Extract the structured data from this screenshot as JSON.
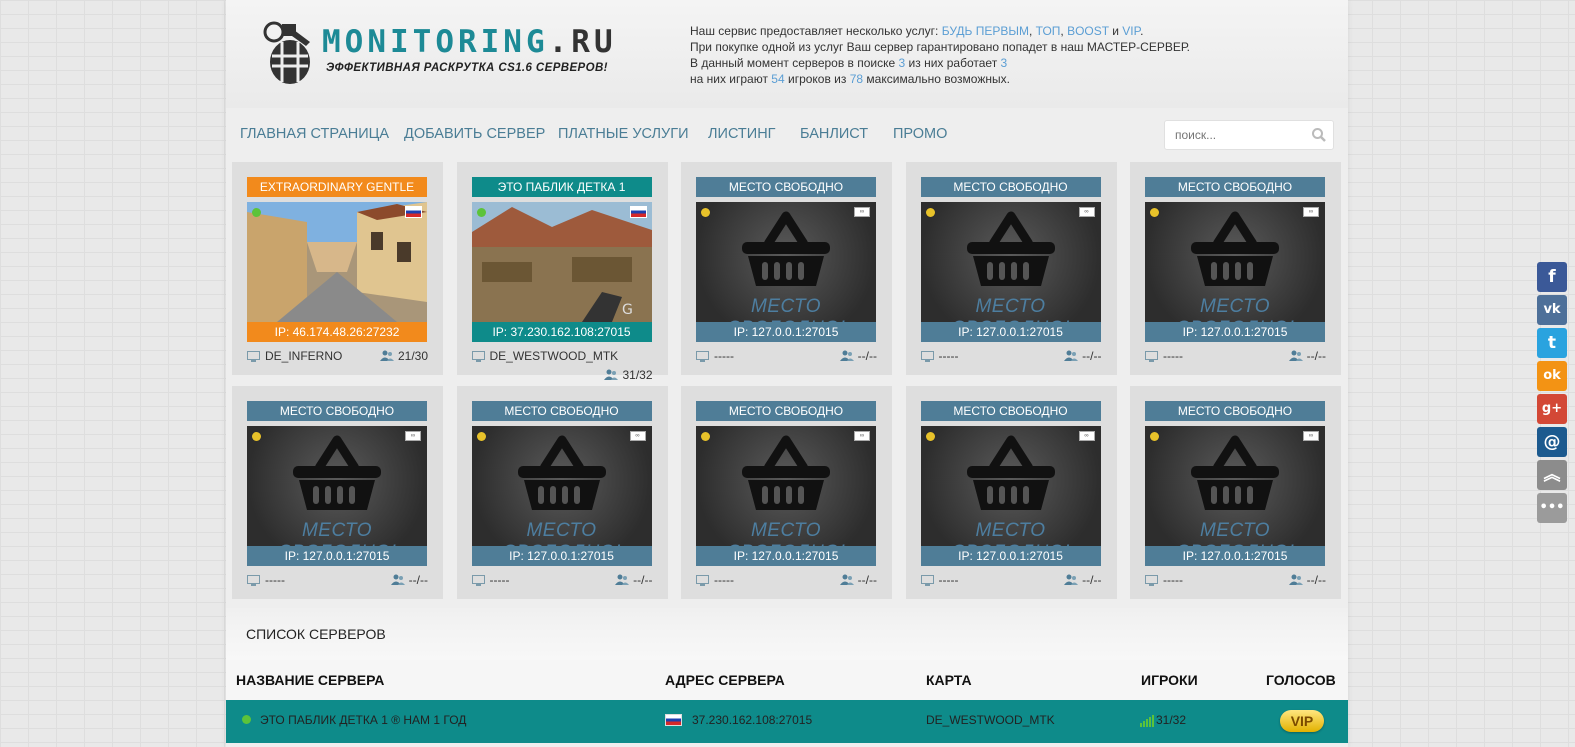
{
  "logo": {
    "title": "MONITORING",
    "title_suffix": ".RU",
    "subtitle": "ЭФФЕКТИВНАЯ РАСКРУТКА CS1.6 СЕРВЕРОВ!"
  },
  "info": {
    "line1_prefix": "Наш сервис предоставляет несколько услуг: ",
    "svc1": "БУДЬ ПЕРВЫМ",
    "sep": ", ",
    "svc2": "ТОП",
    "svc3": "BOOST",
    "and": " и ",
    "svc4": "VIP",
    "dot": ".",
    "line2": "При покупке одной из услуг Ваш сервер гарантировано попадет в наш МАСТЕР-СЕРВЕР.",
    "line3_a": "В данный момент серверов в поиске ",
    "servers_search": "3",
    "line3_b": " из них работает ",
    "servers_working": "3",
    "line4_a": "на них играют ",
    "players_now": "54",
    "line4_b": " игроков из ",
    "players_max": "78",
    "line4_c": " максимально возможных."
  },
  "nav": {
    "items": [
      "Главная страница",
      "Добавить сервер",
      "Платные услуги",
      "Листинг",
      "Банлист",
      "Промо"
    ],
    "search_placeholder": "поиск..."
  },
  "cards": [
    {
      "title": "EXTRAORDINARY GENTLE",
      "ip": "IP: 46.174.48.26:27232",
      "map": "DE_INFERNO",
      "players": "21/30",
      "color": "#f28a1c",
      "type": "inferno"
    },
    {
      "title": "ЭТО ПАБЛИК ДЕТКА 1",
      "ip": "IP: 37.230.162.108:27015",
      "map": "DE_WESTWOOD_MTK",
      "players": "31/32",
      "color": "#0e8b8a",
      "type": "westwood"
    },
    {
      "title": "МЕСТО СВОБОДНО",
      "ip": "IP: 127.0.0.1:27015",
      "map": "-----",
      "players": "--/--",
      "color": "#4f7d97",
      "type": "free"
    },
    {
      "title": "МЕСТО СВОБОДНО",
      "ip": "IP: 127.0.0.1:27015",
      "map": "-----",
      "players": "--/--",
      "color": "#4f7d97",
      "type": "free"
    },
    {
      "title": "МЕСТО СВОБОДНО",
      "ip": "IP: 127.0.0.1:27015",
      "map": "-----",
      "players": "--/--",
      "color": "#4f7d97",
      "type": "free"
    },
    {
      "title": "МЕСТО СВОБОДНО",
      "ip": "IP: 127.0.0.1:27015",
      "map": "-----",
      "players": "--/--",
      "color": "#4f7d97",
      "type": "free"
    },
    {
      "title": "МЕСТО СВОБОДНО",
      "ip": "IP: 127.0.0.1:27015",
      "map": "-----",
      "players": "--/--",
      "color": "#4f7d97",
      "type": "free"
    },
    {
      "title": "МЕСТО СВОБОДНО",
      "ip": "IP: 127.0.0.1:27015",
      "map": "-----",
      "players": "--/--",
      "color": "#4f7d97",
      "type": "free"
    },
    {
      "title": "МЕСТО СВОБОДНО",
      "ip": "IP: 127.0.0.1:27015",
      "map": "-----",
      "players": "--/--",
      "color": "#4f7d97",
      "type": "free"
    },
    {
      "title": "МЕСТО СВОБОДНО",
      "ip": "IP: 127.0.0.1:27015",
      "map": "-----",
      "players": "--/--",
      "color": "#4f7d97",
      "type": "free"
    }
  ],
  "free_image_text": "МЕСТО СВОБОДНО!",
  "server_list": {
    "title": "СПИСОК СЕРВЕРОВ",
    "columns": [
      "НАЗВАНИЕ СЕРВЕРА",
      "АДРЕС СЕРВЕРА",
      "КАРТА",
      "ИГРОКИ",
      "ГОЛОСОВ"
    ],
    "rows": [
      {
        "name": "ЭТО ПАБЛИК ДЕТКА 1 ® НАМ 1 ГОД",
        "address": "37.230.162.108:27015",
        "map": "DE_WESTWOOD_MTK",
        "players": "31/32",
        "votes_badge": "VIP"
      }
    ]
  },
  "social": [
    {
      "icon": "facebook-icon",
      "glyph": "f",
      "color": "#3b5998"
    },
    {
      "icon": "vk-icon",
      "glyph": "vk",
      "color": "#4e7099"
    },
    {
      "icon": "twitter-icon",
      "glyph": "t",
      "color": "#2aa3df"
    },
    {
      "icon": "odnoklassniki-icon",
      "glyph": "ok",
      "color": "#f39314"
    },
    {
      "icon": "google-plus-icon",
      "glyph": "g+",
      "color": "#d34836"
    },
    {
      "icon": "mailru-icon",
      "glyph": "@",
      "color": "#1c5a8f"
    },
    {
      "icon": "scroll-up-icon",
      "glyph": "︽",
      "color": "#8c8c8c"
    },
    {
      "icon": "more-icon",
      "glyph": "•••",
      "color": "#9b9b9b"
    }
  ]
}
